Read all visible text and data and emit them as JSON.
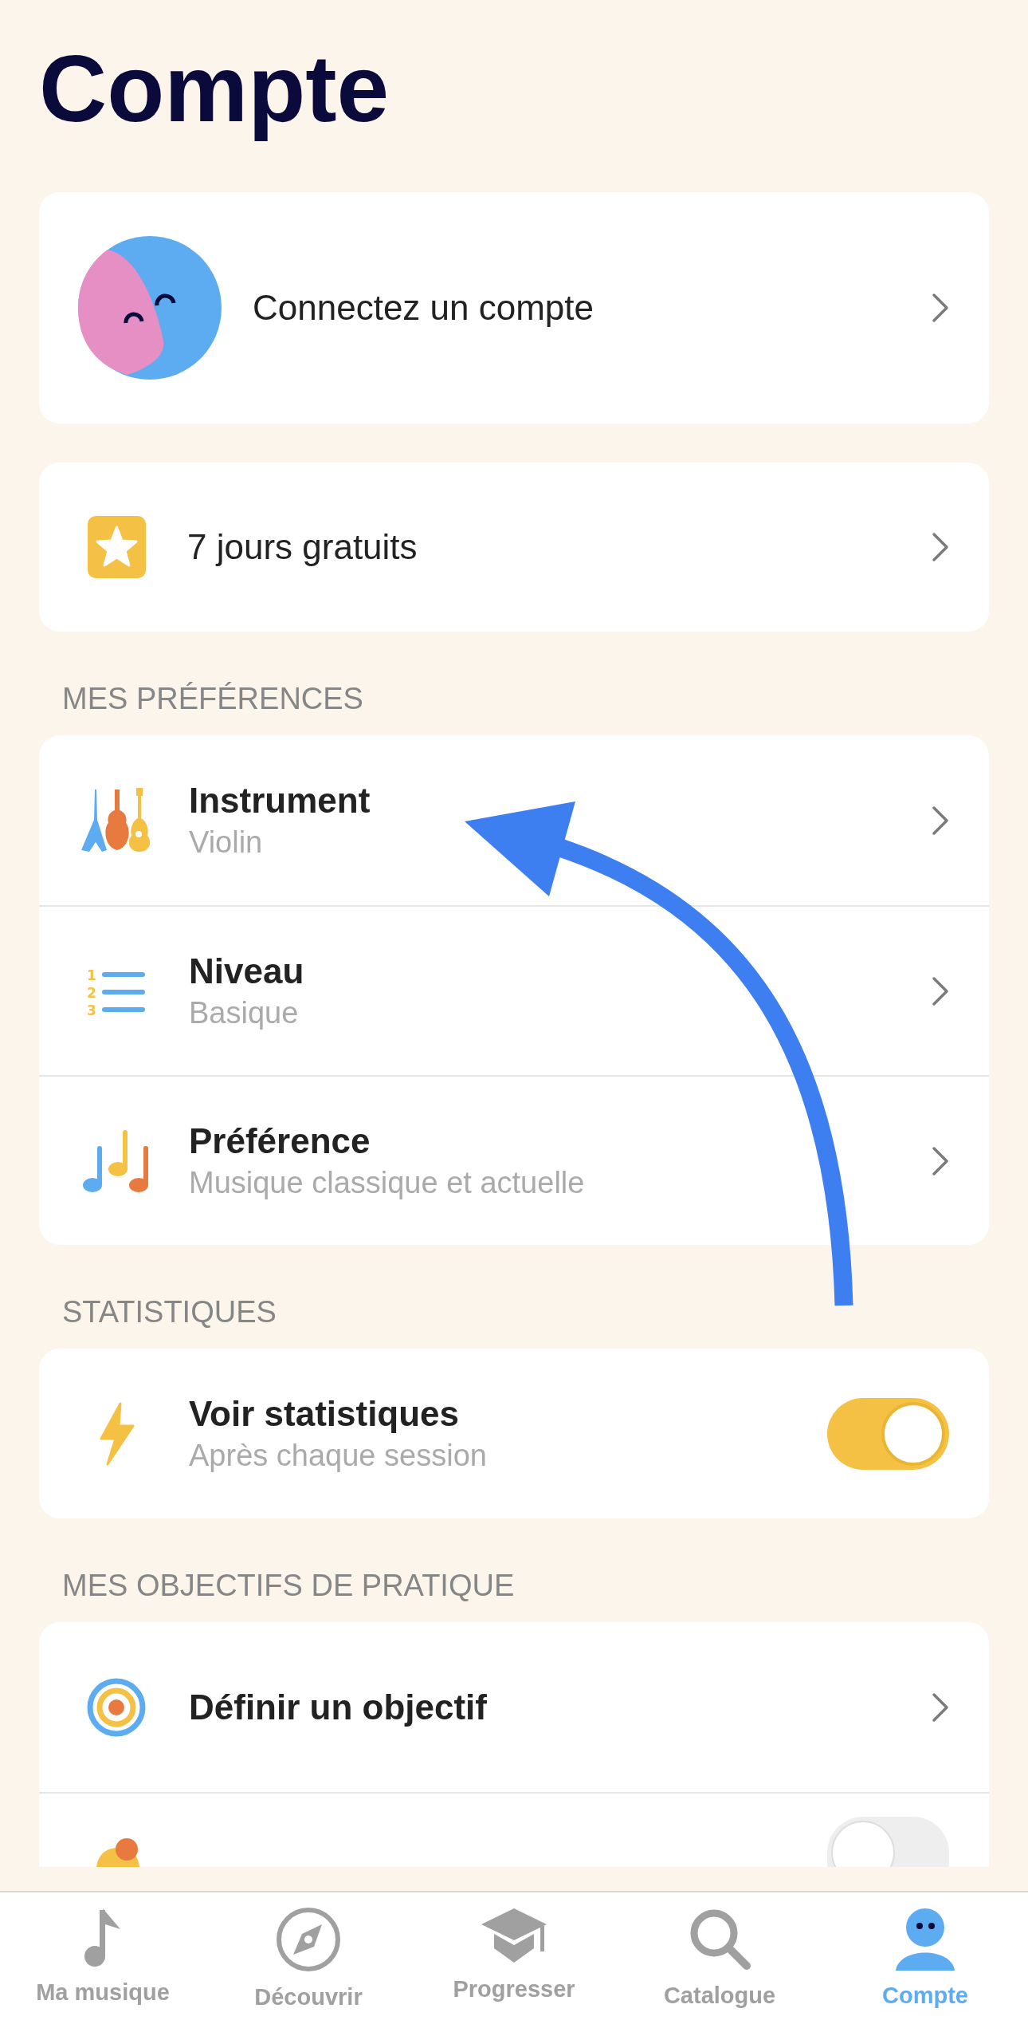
{
  "title": "Compte",
  "account": {
    "label": "Connectez un compte"
  },
  "trial": {
    "label": "7 jours gratuits"
  },
  "sections": [
    {
      "header": "MES PRÉFÉRENCES",
      "rows": [
        {
          "kind": "link",
          "title": "Instrument",
          "subtitle": "Violin"
        },
        {
          "kind": "link",
          "title": "Niveau",
          "subtitle": "Basique",
          "icon_numbers": [
            "1",
            "2",
            "3"
          ]
        },
        {
          "kind": "link",
          "title": "Préférence",
          "subtitle": "Musique classique et actuelle"
        }
      ]
    },
    {
      "header": "STATISTIQUES",
      "rows": [
        {
          "kind": "toggle",
          "title": "Voir statistiques",
          "subtitle": "Après chaque session",
          "on": true
        }
      ]
    },
    {
      "header": "MES OBJECTIFS DE PRATIQUE",
      "rows": [
        {
          "kind": "link",
          "title": "Définir un objectif"
        },
        {
          "kind": "toggle",
          "on": false
        }
      ]
    }
  ],
  "tabs": [
    {
      "label": "Ma musique",
      "selected": false
    },
    {
      "label": "Découvrir",
      "selected": false
    },
    {
      "label": "Progresser",
      "selected": false
    },
    {
      "label": "Catalogue",
      "selected": false
    },
    {
      "label": "Compte",
      "selected": true
    }
  ]
}
